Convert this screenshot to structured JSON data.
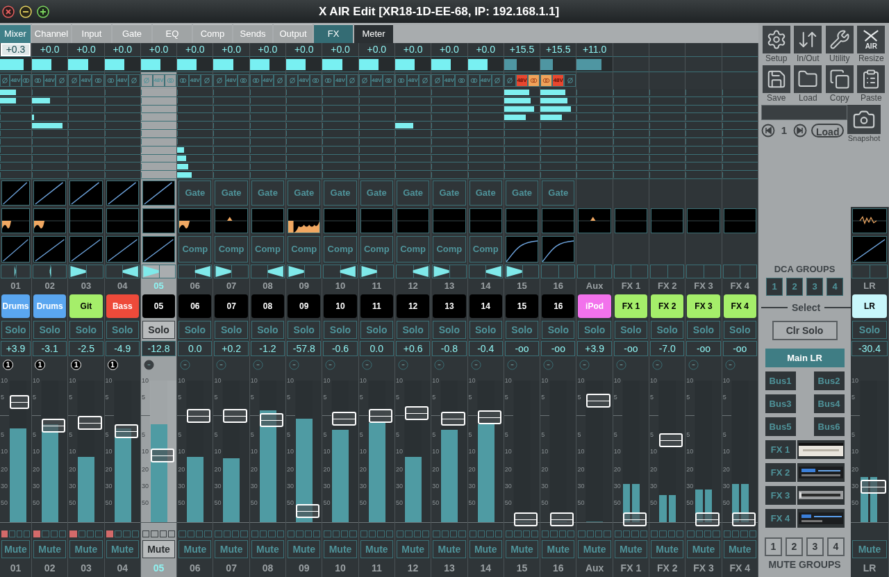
{
  "title": "X AIR Edit [XR18-1D-EE-68, IP: 192.168.1.1]",
  "tabs": [
    {
      "label": "Mixer",
      "kind": "standard",
      "selected": true
    },
    {
      "label": "Channel",
      "kind": "standard",
      "selected": false
    },
    {
      "label": "Input",
      "kind": "standard",
      "selected": false
    },
    {
      "label": "Gate",
      "kind": "standard",
      "selected": false
    },
    {
      "label": "EQ",
      "kind": "standard",
      "selected": false
    },
    {
      "label": "Comp",
      "kind": "standard",
      "selected": false
    },
    {
      "label": "Sends",
      "kind": "standard",
      "selected": false
    },
    {
      "label": "Output",
      "kind": "standard",
      "selected": false
    },
    {
      "label": "FX",
      "kind": "effects",
      "selected": false
    },
    {
      "label": "Meter",
      "kind": "meter",
      "selected": false
    }
  ],
  "strips": [
    {
      "kind": "channel",
      "selected": false,
      "gain": {
        "text": "+0.3",
        "focused": true
      },
      "trim": {
        "level": 0.75,
        "active": true
      },
      "phantom": {
        "label": "48V",
        "on": false
      },
      "link": {
        "on": false
      },
      "sends": [
        {
          "level": 0.5
        },
        {
          "level": 0.5
        },
        {
          "level": 0
        },
        {
          "level": 0
        },
        {
          "level": 0
        },
        {
          "level": 0
        },
        {
          "level": 0
        },
        {
          "level": 0
        },
        {
          "level": 0
        },
        {
          "level": 0
        },
        {
          "level": 0
        }
      ],
      "gate": {
        "kind": "graph"
      },
      "eq": {
        "kind": "dip"
      },
      "comp": {
        "kind": "graph"
      },
      "pan": {
        "left": true,
        "full": false
      },
      "number": "01",
      "name": "Drums",
      "color": "#5aa6f0",
      "solo": "Solo",
      "value": "+3.9",
      "dca": "1",
      "scale": [
        "10",
        "5",
        "5",
        "10",
        "20",
        "30",
        "50"
      ],
      "fader": {
        "level": 0.85
      },
      "meter": {
        "level": 0.66
      },
      "mute_groups": [
        true,
        false,
        false,
        false
      ],
      "mute": "Mute",
      "label": "01"
    },
    {
      "kind": "channel",
      "selected": false,
      "gain": {
        "text": "+0.0",
        "focused": false
      },
      "trim": {
        "level": 0.55,
        "active": true
      },
      "phantom": {
        "label": "48V",
        "on": false
      },
      "link": {
        "on": false
      },
      "sends": [
        {
          "level": 0
        },
        {
          "level": 0.5
        },
        {
          "level": 0
        },
        {
          "level": 0.06
        },
        {
          "level": 0.85
        },
        {
          "level": 0
        },
        {
          "level": 0
        },
        {
          "level": 0
        },
        {
          "level": 0
        },
        {
          "level": 0
        },
        {
          "level": 0
        }
      ],
      "gate": {
        "kind": "graph"
      },
      "eq": {
        "kind": "dip"
      },
      "comp": {
        "kind": "graph"
      },
      "pan": {
        "left": false,
        "full": false
      },
      "number": "02",
      "name": "Drums",
      "color": "#5aa6f0",
      "solo": "Solo",
      "value": "-3.1",
      "dca": "1",
      "scale": [
        "10",
        "5",
        "5",
        "10",
        "20",
        "30",
        "50"
      ],
      "fader": {
        "level": 0.68
      },
      "meter": {
        "level": 0.69
      },
      "mute_groups": [
        true,
        false,
        false,
        false
      ],
      "mute": "Mute",
      "label": "02"
    },
    {
      "kind": "channel",
      "selected": false,
      "gain": {
        "text": "+0.0",
        "focused": false
      },
      "trim": {
        "level": 0.55,
        "active": true
      },
      "phantom": {
        "label": "48V",
        "on": false
      },
      "link": {
        "on": false
      },
      "sends": [
        {
          "level": 0
        },
        {
          "level": 0
        },
        {
          "level": 0
        },
        {
          "level": 0
        },
        {
          "level": 0
        },
        {
          "level": 0
        },
        {
          "level": 0
        },
        {
          "level": 0
        },
        {
          "level": 0
        },
        {
          "level": 0
        },
        {
          "level": 0
        }
      ],
      "gate": {
        "kind": "graph"
      },
      "eq": {
        "kind": "flat"
      },
      "comp": {
        "kind": "graph"
      },
      "pan": {
        "left": true,
        "full": true
      },
      "number": "03",
      "name": "Git",
      "color": "#a5ee6a",
      "solo": "Solo",
      "value": "-2.5",
      "dca": "1",
      "scale": [
        "10",
        "5",
        "5",
        "10",
        "20",
        "30",
        "50"
      ],
      "fader": {
        "level": 0.7
      },
      "meter": {
        "level": 0.46
      },
      "mute_groups": [
        true,
        false,
        false,
        false
      ],
      "mute": "Mute",
      "label": "03"
    },
    {
      "kind": "channel",
      "selected": false,
      "gain": {
        "text": "+0.0",
        "focused": false
      },
      "trim": {
        "level": 0.55,
        "active": true
      },
      "phantom": {
        "label": "48V",
        "on": false
      },
      "link": {
        "on": false
      },
      "sends": [
        {
          "level": 0
        },
        {
          "level": 0
        },
        {
          "level": 0
        },
        {
          "level": 0
        },
        {
          "level": 0
        },
        {
          "level": 0
        },
        {
          "level": 0
        },
        {
          "level": 0
        },
        {
          "level": 0
        },
        {
          "level": 0
        },
        {
          "level": 0
        }
      ],
      "gate": {
        "kind": "graph"
      },
      "eq": {
        "kind": "flat"
      },
      "comp": {
        "kind": "graph"
      },
      "pan": {
        "left": false,
        "full": true
      },
      "number": "04",
      "name": "Bass",
      "color": "#ee4a3a",
      "solo": "Solo",
      "value": "-4.9",
      "dca": "1",
      "scale": [
        "10",
        "5",
        "5",
        "10",
        "20",
        "30",
        "50"
      ],
      "fader": {
        "level": 0.64
      },
      "meter": {
        "level": 0.66
      },
      "mute_groups": [
        true,
        false,
        false,
        false
      ],
      "mute": "Mute",
      "label": "04"
    },
    {
      "kind": "channel",
      "selected": true,
      "gain": {
        "text": "+0.0",
        "focused": false
      },
      "trim": {
        "level": 0.55,
        "active": true
      },
      "phantom": {
        "label": "48V",
        "on": false
      },
      "link": {
        "on": false
      },
      "sends": [
        {
          "level": 0
        },
        {
          "level": 0
        },
        {
          "level": 0
        },
        {
          "level": 0
        },
        {
          "level": 0
        },
        {
          "level": 0
        },
        {
          "level": 0
        },
        {
          "level": 0
        },
        {
          "level": 0
        },
        {
          "level": 0
        },
        {
          "level": 0
        }
      ],
      "gate": {
        "kind": "graph"
      },
      "eq": {
        "kind": "flat"
      },
      "comp": {
        "kind": "graph"
      },
      "pan": {
        "left": true,
        "full": true
      },
      "number": "05",
      "name": "05",
      "color": "#000000",
      "solo": "Solo",
      "value": "-12.8",
      "scale": [
        "10",
        "5",
        "5",
        "10",
        "20",
        "30",
        "50"
      ],
      "fader": {
        "level": 0.47
      },
      "meter": {
        "level": 0.69
      },
      "mute_groups": [
        false,
        false,
        false,
        false
      ],
      "mute": "Mute",
      "label": "05"
    },
    {
      "kind": "channel",
      "selected": false,
      "gain": {
        "text": "+0.0",
        "focused": false
      },
      "trim": {
        "level": 0.55,
        "active": true
      },
      "phantom": {
        "label": "48V",
        "on": false
      },
      "link": {
        "on": false
      },
      "sends": [
        {
          "level": 0
        },
        {
          "level": 0
        },
        {
          "level": 0
        },
        {
          "level": 0
        },
        {
          "level": 0
        },
        {
          "level": 0
        },
        {
          "level": 0
        },
        {
          "level": 0.2
        },
        {
          "level": 0.25
        },
        {
          "level": 0.3
        },
        {
          "level": 0.4
        }
      ],
      "gate": {
        "kind": "button",
        "label": "Gate"
      },
      "eq": {
        "kind": "dip"
      },
      "comp": {
        "kind": "button",
        "label": "Comp"
      },
      "pan": {
        "left": false,
        "full": true
      },
      "number": "06",
      "name": "06",
      "color": "#000000",
      "solo": "Solo",
      "value": "0.0",
      "scale": [
        "10",
        "5",
        "5",
        "10",
        "20",
        "30",
        "50"
      ],
      "fader": {
        "level": 0.75
      },
      "meter": {
        "level": 0.46
      },
      "mute_groups": [
        false,
        false,
        false,
        false
      ],
      "mute": "Mute",
      "label": "06"
    },
    {
      "kind": "channel",
      "selected": false,
      "gain": {
        "text": "+0.0",
        "focused": false
      },
      "trim": {
        "level": 0.55,
        "active": true
      },
      "phantom": {
        "label": "48V",
        "on": false
      },
      "link": {
        "on": false
      },
      "sends": [
        {
          "level": 0
        },
        {
          "level": 0
        },
        {
          "level": 0
        },
        {
          "level": 0
        },
        {
          "level": 0
        },
        {
          "level": 0
        },
        {
          "level": 0
        },
        {
          "level": 0
        },
        {
          "level": 0
        },
        {
          "level": 0
        },
        {
          "level": 0
        }
      ],
      "gate": {
        "kind": "button",
        "label": "Gate"
      },
      "eq": {
        "kind": "peak"
      },
      "comp": {
        "kind": "button",
        "label": "Comp"
      },
      "pan": {
        "left": true,
        "full": true
      },
      "number": "07",
      "name": "07",
      "color": "#000000",
      "solo": "Solo",
      "value": "+0.2",
      "scale": [
        "10",
        "5",
        "5",
        "10",
        "20",
        "30",
        "50"
      ],
      "fader": {
        "level": 0.75
      },
      "meter": {
        "level": 0.45
      },
      "mute_groups": [
        false,
        false,
        false,
        false
      ],
      "mute": "Mute",
      "label": "07"
    },
    {
      "kind": "channel",
      "selected": false,
      "gain": {
        "text": "+0.0",
        "focused": false
      },
      "trim": {
        "level": 0.55,
        "active": true
      },
      "phantom": {
        "label": "48V",
        "on": false
      },
      "link": {
        "on": false
      },
      "sends": [
        {
          "level": 0
        },
        {
          "level": 0
        },
        {
          "level": 0
        },
        {
          "level": 0
        },
        {
          "level": 0
        },
        {
          "level": 0
        },
        {
          "level": 0
        },
        {
          "level": 0
        },
        {
          "level": 0
        },
        {
          "level": 0
        },
        {
          "level": 0
        }
      ],
      "gate": {
        "kind": "button",
        "label": "Gate"
      },
      "eq": {
        "kind": "flat"
      },
      "comp": {
        "kind": "button",
        "label": "Comp"
      },
      "pan": {
        "left": false,
        "full": true
      },
      "number": "08",
      "name": "08",
      "color": "#000000",
      "solo": "Solo",
      "value": "-1.2",
      "scale": [
        "10",
        "5",
        "5",
        "10",
        "20",
        "30",
        "50"
      ],
      "fader": {
        "level": 0.72
      },
      "meter": {
        "level": 0.79
      },
      "mute_groups": [
        false,
        false,
        false,
        false
      ],
      "mute": "Mute",
      "label": "08"
    },
    {
      "kind": "channel",
      "selected": false,
      "gain": {
        "text": "+0.0",
        "focused": false
      },
      "trim": {
        "level": 0.55,
        "active": true
      },
      "phantom": {
        "label": "48V",
        "on": false
      },
      "link": {
        "on": false
      },
      "sends": [
        {
          "level": 0
        },
        {
          "level": 0
        },
        {
          "level": 0
        },
        {
          "level": 0
        },
        {
          "level": 0
        },
        {
          "level": 0
        },
        {
          "level": 0
        },
        {
          "level": 0
        },
        {
          "level": 0
        },
        {
          "level": 0
        },
        {
          "level": 0
        }
      ],
      "gate": {
        "kind": "button",
        "label": "Gate"
      },
      "eq": {
        "kind": "wide"
      },
      "comp": {
        "kind": "button",
        "label": "Comp"
      },
      "pan": {
        "left": true,
        "full": true
      },
      "number": "09",
      "name": "09",
      "color": "#000000",
      "solo": "Solo",
      "value": "-57.8",
      "scale": [
        "10",
        "5",
        "5",
        "10",
        "20",
        "30",
        "50"
      ],
      "fader": {
        "level": 0.08
      },
      "meter": {
        "level": 0.73
      },
      "mute_groups": [
        false,
        false,
        false,
        false
      ],
      "mute": "Mute",
      "label": "09"
    },
    {
      "kind": "channel",
      "selected": false,
      "gain": {
        "text": "+0.0",
        "focused": false
      },
      "trim": {
        "level": 0.55,
        "active": true
      },
      "phantom": {
        "label": "48V",
        "on": false
      },
      "link": {
        "on": false
      },
      "sends": [
        {
          "level": 0
        },
        {
          "level": 0
        },
        {
          "level": 0
        },
        {
          "level": 0
        },
        {
          "level": 0
        },
        {
          "level": 0
        },
        {
          "level": 0
        },
        {
          "level": 0
        },
        {
          "level": 0
        },
        {
          "level": 0
        },
        {
          "level": 0
        }
      ],
      "gate": {
        "kind": "button",
        "label": "Gate"
      },
      "eq": {
        "kind": "flat"
      },
      "comp": {
        "kind": "button",
        "label": "Comp"
      },
      "pan": {
        "left": false,
        "full": true
      },
      "number": "10",
      "name": "10",
      "color": "#000000",
      "solo": "Solo",
      "value": "-0.6",
      "scale": [
        "10",
        "5",
        "5",
        "10",
        "20",
        "30",
        "50"
      ],
      "fader": {
        "level": 0.73
      },
      "meter": {
        "level": 0.65
      },
      "mute_groups": [
        false,
        false,
        false,
        false
      ],
      "mute": "Mute",
      "label": "10"
    },
    {
      "kind": "channel",
      "selected": false,
      "gain": {
        "text": "+0.0",
        "focused": false
      },
      "trim": {
        "level": 0.55,
        "active": true
      },
      "phantom": {
        "label": "48V",
        "on": false
      },
      "link": {
        "on": false
      },
      "sends": [
        {
          "level": 0
        },
        {
          "level": 0
        },
        {
          "level": 0
        },
        {
          "level": 0
        },
        {
          "level": 0
        },
        {
          "level": 0
        },
        {
          "level": 0
        },
        {
          "level": 0
        },
        {
          "level": 0
        },
        {
          "level": 0
        },
        {
          "level": 0
        }
      ],
      "gate": {
        "kind": "button",
        "label": "Gate"
      },
      "eq": {
        "kind": "flat"
      },
      "comp": {
        "kind": "button",
        "label": "Comp"
      },
      "pan": {
        "left": true,
        "full": true
      },
      "number": "11",
      "name": "11",
      "color": "#000000",
      "solo": "Solo",
      "value": "0.0",
      "scale": [
        "10",
        "5",
        "5",
        "10",
        "20",
        "30",
        "50"
      ],
      "fader": {
        "level": 0.75
      },
      "meter": {
        "level": 0.7
      },
      "mute_groups": [
        false,
        false,
        false,
        false
      ],
      "mute": "Mute",
      "label": "11"
    },
    {
      "kind": "channel",
      "selected": false,
      "gain": {
        "text": "+0.0",
        "focused": false
      },
      "trim": {
        "level": 0.55,
        "active": true
      },
      "phantom": {
        "label": "48V",
        "on": false
      },
      "link": {
        "on": false
      },
      "sends": [
        {
          "level": 0
        },
        {
          "level": 0
        },
        {
          "level": 0
        },
        {
          "level": 0
        },
        {
          "level": 0.5
        },
        {
          "level": 0
        },
        {
          "level": 0
        },
        {
          "level": 0
        },
        {
          "level": 0
        },
        {
          "level": 0
        },
        {
          "level": 0
        }
      ],
      "gate": {
        "kind": "button",
        "label": "Gate"
      },
      "eq": {
        "kind": "flat"
      },
      "comp": {
        "kind": "button",
        "label": "Comp"
      },
      "pan": {
        "left": false,
        "full": true
      },
      "number": "12",
      "name": "12",
      "color": "#000000",
      "solo": "Solo",
      "value": "+0.6",
      "scale": [
        "10",
        "5",
        "5",
        "10",
        "20",
        "30",
        "50"
      ],
      "fader": {
        "level": 0.77
      },
      "meter": {
        "level": 0.46
      },
      "mute_groups": [
        false,
        false,
        false,
        false
      ],
      "mute": "Mute",
      "label": "12"
    },
    {
      "kind": "channel",
      "selected": false,
      "gain": {
        "text": "+0.0",
        "focused": false
      },
      "trim": {
        "level": 0.55,
        "active": true
      },
      "phantom": {
        "label": "48V",
        "on": false
      },
      "link": {
        "on": false
      },
      "sends": [
        {
          "level": 0
        },
        {
          "level": 0
        },
        {
          "level": 0
        },
        {
          "level": 0
        },
        {
          "level": 0
        },
        {
          "level": 0
        },
        {
          "level": 0
        },
        {
          "level": 0
        },
        {
          "level": 0
        },
        {
          "level": 0
        },
        {
          "level": 0
        }
      ],
      "gate": {
        "kind": "button",
        "label": "Gate"
      },
      "eq": {
        "kind": "flat"
      },
      "comp": {
        "kind": "button",
        "label": "Comp"
      },
      "pan": {
        "left": true,
        "full": true
      },
      "number": "13",
      "name": "13",
      "color": "#000000",
      "solo": "Solo",
      "value": "-0.8",
      "scale": [
        "10",
        "5",
        "5",
        "10",
        "20",
        "30",
        "50"
      ],
      "fader": {
        "level": 0.73
      },
      "meter": {
        "level": 0.65
      },
      "mute_groups": [
        false,
        false,
        false,
        false
      ],
      "mute": "Mute",
      "label": "13"
    },
    {
      "kind": "channel",
      "selected": false,
      "gain": {
        "text": "+0.0",
        "focused": false
      },
      "trim": {
        "level": 0.55,
        "active": true
      },
      "phantom": {
        "label": "48V",
        "on": false
      },
      "link": {
        "on": false
      },
      "sends": [
        {
          "level": 0
        },
        {
          "level": 0
        },
        {
          "level": 0
        },
        {
          "level": 0
        },
        {
          "level": 0
        },
        {
          "level": 0
        },
        {
          "level": 0
        },
        {
          "level": 0
        },
        {
          "level": 0
        },
        {
          "level": 0
        },
        {
          "level": 0
        }
      ],
      "gate": {
        "kind": "button",
        "label": "Gate"
      },
      "eq": {
        "kind": "flat"
      },
      "comp": {
        "kind": "button",
        "label": "Comp"
      },
      "pan": {
        "left": false,
        "full": true
      },
      "number": "14",
      "name": "14",
      "color": "#000000",
      "solo": "Solo",
      "value": "-0.4",
      "scale": [
        "10",
        "5",
        "5",
        "10",
        "20",
        "30",
        "50"
      ],
      "fader": {
        "level": 0.74
      },
      "meter": {
        "level": 0.69
      },
      "mute_groups": [
        false,
        false,
        false,
        false
      ],
      "mute": "Mute",
      "label": "14"
    },
    {
      "kind": "channel",
      "selected": false,
      "gain": {
        "text": "+15.5",
        "focused": false
      },
      "trim": {
        "level": 0.35,
        "active": false
      },
      "phantom": {
        "label": "48V",
        "on": true
      },
      "link": {
        "on": true
      },
      "sends": [
        {
          "level": 0.7
        },
        {
          "level": 0.75
        },
        {
          "level": 0.85
        },
        {
          "level": 0.6
        },
        {
          "level": 0
        },
        {
          "level": 0
        },
        {
          "level": 0
        },
        {
          "level": 0
        },
        {
          "level": 0
        },
        {
          "level": 0
        },
        {
          "level": 0
        }
      ],
      "gate": {
        "kind": "button",
        "label": "Gate"
      },
      "eq": {
        "kind": "flat"
      },
      "comp": {
        "kind": "curve"
      },
      "pan": {
        "left": true,
        "full": true
      },
      "number": "15",
      "name": "15",
      "color": "#000000",
      "solo": "Solo",
      "value": "-oo",
      "scale": [
        "10",
        "5",
        "5",
        "10",
        "20",
        "30",
        "50"
      ],
      "fader": {
        "level": 0.02
      },
      "meter": {
        "level": 0
      },
      "mute_groups": [
        false,
        false,
        false,
        false
      ],
      "mute": "Mute",
      "label": "15"
    },
    {
      "kind": "channel",
      "selected": false,
      "gain": {
        "text": "+15.5",
        "focused": false
      },
      "trim": {
        "level": 0.35,
        "active": false
      },
      "phantom": {
        "label": "48V",
        "on": true
      },
      "link": {
        "on": true
      },
      "sends": [
        {
          "level": 0.7
        },
        {
          "level": 0.75
        },
        {
          "level": 0.85
        },
        {
          "level": 0.6
        },
        {
          "level": 0
        },
        {
          "level": 0
        },
        {
          "level": 0
        },
        {
          "level": 0
        },
        {
          "level": 0
        },
        {
          "level": 0
        },
        {
          "level": 0
        }
      ],
      "gate": {
        "kind": "button",
        "label": "Gate"
      },
      "eq": {
        "kind": "flat"
      },
      "comp": {
        "kind": "curve"
      },
      "number": "16",
      "name": "16",
      "color": "#000000",
      "solo": "Solo",
      "value": "-oo",
      "scale": [
        "10",
        "5",
        "5",
        "10",
        "20",
        "30",
        "50"
      ],
      "fader": {
        "level": 0.02
      },
      "meter": {
        "level": 0
      },
      "mute_groups": [
        false,
        false,
        false,
        false
      ],
      "mute": "Mute",
      "label": "16"
    },
    {
      "kind": "aux",
      "selected": false,
      "gain": {
        "text": "+11.0",
        "focused": false
      },
      "trim": {
        "level": 0.7,
        "active": false
      },
      "sends": [
        {
          "level": 0
        },
        {
          "level": 0
        },
        {
          "level": 0
        },
        {
          "level": 0
        },
        {
          "level": 0
        },
        {
          "level": 0
        },
        {
          "level": 0
        },
        {
          "level": 0
        },
        {
          "level": 0
        },
        {
          "level": 0
        },
        {
          "level": 0
        }
      ],
      "eq": {
        "kind": "peak"
      },
      "number": "Aux",
      "name": "iPod",
      "color": "#f272ec",
      "solo": "Solo",
      "value": "+3.9",
      "scale": [
        "10",
        "5",
        "5",
        "10",
        "20",
        "30",
        "50"
      ],
      "fader": {
        "level": 0.86
      },
      "meter": {
        "level": 0
      },
      "mute_groups": [
        false,
        false,
        false,
        false
      ],
      "mute": "Mute",
      "label": "Aux"
    },
    {
      "kind": "fx",
      "selected": false,
      "sends": [
        {
          "level": 0
        },
        {
          "level": 0
        },
        {
          "level": 0
        },
        {
          "level": 0
        },
        {
          "level": 0
        },
        {
          "level": 0
        },
        {
          "level": 0
        },
        {
          "level": 0
        },
        {
          "level": 0
        },
        {
          "level": 0
        },
        {
          "level": 0
        }
      ],
      "eq": {
        "kind": "flat"
      },
      "number": "FX 1",
      "name": "FX 1",
      "color": "#a5ee6a",
      "solo": "Solo",
      "value": "-oo",
      "scale": [
        "10",
        "5",
        "5",
        "10",
        "20",
        "30",
        "50"
      ],
      "fader": {
        "level": 0.02
      },
      "meter": {
        "level": 0.27
      },
      "mute_groups": [
        false,
        false,
        false,
        false
      ],
      "mute": "Mute",
      "label": "FX 1"
    },
    {
      "kind": "fx",
      "selected": false,
      "sends": [
        {
          "level": 0
        },
        {
          "level": 0
        },
        {
          "level": 0
        },
        {
          "level": 0
        },
        {
          "level": 0
        },
        {
          "level": 0
        },
        {
          "level": 0
        },
        {
          "level": 0
        },
        {
          "level": 0
        },
        {
          "level": 0
        },
        {
          "level": 0
        }
      ],
      "eq": {
        "kind": "flat"
      },
      "number": "FX 2",
      "name": "FX 2",
      "color": "#a5ee6a",
      "solo": "Solo",
      "value": "-7.0",
      "scale": [
        "10",
        "5",
        "5",
        "10",
        "20",
        "30",
        "50"
      ],
      "fader": {
        "level": 0.58
      },
      "meter": {
        "level": 0.19
      },
      "mute_groups": [
        false,
        false,
        false,
        false
      ],
      "mute": "Mute",
      "label": "FX 2"
    },
    {
      "kind": "fx",
      "selected": false,
      "sends": [
        {
          "level": 0
        },
        {
          "level": 0
        },
        {
          "level": 0
        },
        {
          "level": 0
        },
        {
          "level": 0
        },
        {
          "level": 0
        },
        {
          "level": 0
        },
        {
          "level": 0
        },
        {
          "level": 0
        },
        {
          "level": 0
        },
        {
          "level": 0
        }
      ],
      "eq": {
        "kind": "flat"
      },
      "number": "FX 3",
      "name": "FX 3",
      "color": "#a5ee6a",
      "solo": "Solo",
      "value": "-oo",
      "scale": [
        "10",
        "5",
        "5",
        "10",
        "20",
        "30",
        "50"
      ],
      "fader": {
        "level": 0.02
      },
      "meter": {
        "level": 0.23
      },
      "mute_groups": [
        false,
        false,
        false,
        false
      ],
      "mute": "Mute",
      "label": "FX 3"
    },
    {
      "kind": "fx",
      "selected": false,
      "sends": [
        {
          "level": 0
        },
        {
          "level": 0
        },
        {
          "level": 0
        },
        {
          "level": 0
        },
        {
          "level": 0
        },
        {
          "level": 0
        },
        {
          "level": 0
        },
        {
          "level": 0
        },
        {
          "level": 0
        },
        {
          "level": 0
        },
        {
          "level": 0
        }
      ],
      "eq": {
        "kind": "flat"
      },
      "number": "FX 4",
      "name": "FX 4",
      "color": "#a5ee6a",
      "solo": "Solo",
      "value": "-oo",
      "scale": [
        "10",
        "5",
        "5",
        "10",
        "20",
        "30",
        "50"
      ],
      "fader": {
        "level": 0.02
      },
      "meter": {
        "level": 0.27
      },
      "mute_groups": [
        false,
        false,
        false,
        false
      ],
      "mute": "Mute",
      "label": "FX 4"
    }
  ],
  "main": {
    "kind": "main",
    "selected": false,
    "eq": {
      "kind": "wiggle"
    },
    "comp": {
      "kind": "graph"
    },
    "number": "LR",
    "name": "LR",
    "color": "#c8f7fb",
    "solo": "Solo",
    "value": "-30.4",
    "scale": [
      "10",
      "5",
      "5",
      "10",
      "20",
      "30",
      "50"
    ],
    "fader": {
      "level": 0.25
    },
    "meter": {
      "level": 0.32
    },
    "mute": "Mute",
    "label": "LR"
  },
  "tools": [
    {
      "kind": "setup",
      "label": "Setup"
    },
    {
      "kind": "inout",
      "label": "In/Out"
    },
    {
      "kind": "utility",
      "label": "Utility"
    },
    {
      "kind": "resize",
      "label": "Resize",
      "logo": "AIR"
    },
    {
      "kind": "save",
      "label": "Save"
    },
    {
      "kind": "load",
      "label": "Load"
    },
    {
      "kind": "copy",
      "label": "Copy"
    },
    {
      "kind": "paste",
      "label": "Paste"
    }
  ],
  "snapshot": {
    "number": "1",
    "load": "Load",
    "label": "Snapshot"
  },
  "dca_groups": {
    "title": "DCA GROUPS",
    "buttons": [
      "1",
      "2",
      "3",
      "4"
    ]
  },
  "select_label": "Select",
  "clear_solo": "Clr Solo",
  "bus_targets": [
    {
      "kind": "main",
      "label": "Main LR",
      "selected": true
    },
    {
      "kind": "bus",
      "label": "Bus1",
      "selected": false
    },
    {
      "kind": "bus",
      "label": "Bus2",
      "selected": false
    },
    {
      "kind": "bus",
      "label": "Bus3",
      "selected": false
    },
    {
      "kind": "bus",
      "label": "Bus4",
      "selected": false
    },
    {
      "kind": "bus",
      "label": "Bus5",
      "selected": false
    },
    {
      "kind": "bus",
      "label": "Bus6",
      "selected": false
    }
  ],
  "fx_slots": [
    {
      "label": "FX 1"
    },
    {
      "label": "FX 2"
    },
    {
      "label": "FX 3"
    },
    {
      "label": "FX 4"
    }
  ],
  "mute_groups": {
    "title": "MUTE GROUPS",
    "buttons": [
      "1",
      "2",
      "3",
      "4"
    ]
  }
}
